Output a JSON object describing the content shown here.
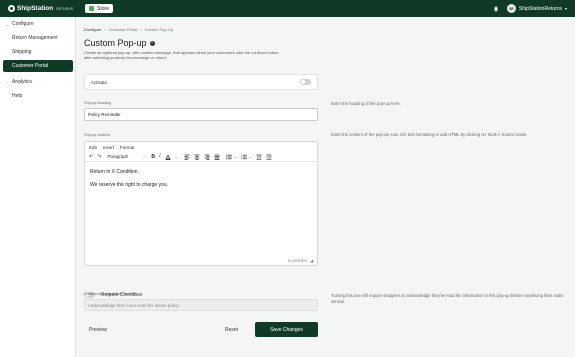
{
  "topbar": {
    "brand": "ShipStation",
    "brand_sub": "RETURNS",
    "store_label": "Store",
    "avatar_initials": "SR",
    "account_name": "ShipStationReturns"
  },
  "sidebar": {
    "items": [
      {
        "label": "Configure"
      },
      {
        "label": "Return Management"
      },
      {
        "label": "Shipping"
      },
      {
        "label": "Customer Portal"
      },
      {
        "label": "Analytics"
      },
      {
        "label": "Help"
      }
    ]
  },
  "breadcrumb": [
    "Configure",
    "Customer Portal",
    "Custom Pop-Up"
  ],
  "page": {
    "title": "Custom Pop-up",
    "description": "Create an optional pop-up, with custom message, that appears when your customers click the continue button after selecting products for exchange or return."
  },
  "activate": {
    "label": "Activate"
  },
  "heading_field": {
    "label": "Pop-up heading",
    "value": "Policy Reminder",
    "hint": "Enter the heading of the pop-up here."
  },
  "content_field": {
    "label": "Pop-up content",
    "hint": "Enter the content of the pop-up. Use rich text formatting or add HTML by clicking on Tools > Source Code."
  },
  "editor": {
    "menu": [
      "Edit",
      "Insert",
      "Format"
    ],
    "block_format": "Paragraph",
    "paragraphs": [
      "Return in X Condition.",
      "We reserve the right to charge you."
    ],
    "word_count": "11 WORDS"
  },
  "require_checkbox": {
    "label": "Require Checkbox",
    "hint": "Turning this one will require shoppers to acknowledge they've read the information in this pop-up before continuing their order service."
  },
  "confirm_field": {
    "label": "Additional confirmation content",
    "placeholder": "I acknowledge that I have read the above policy."
  },
  "actions": {
    "preview": "Preview",
    "reset": "Reset",
    "save": "Save Changes"
  },
  "colors": {
    "brand_dark": "#0f3b26",
    "background": "#f4f5f5"
  }
}
